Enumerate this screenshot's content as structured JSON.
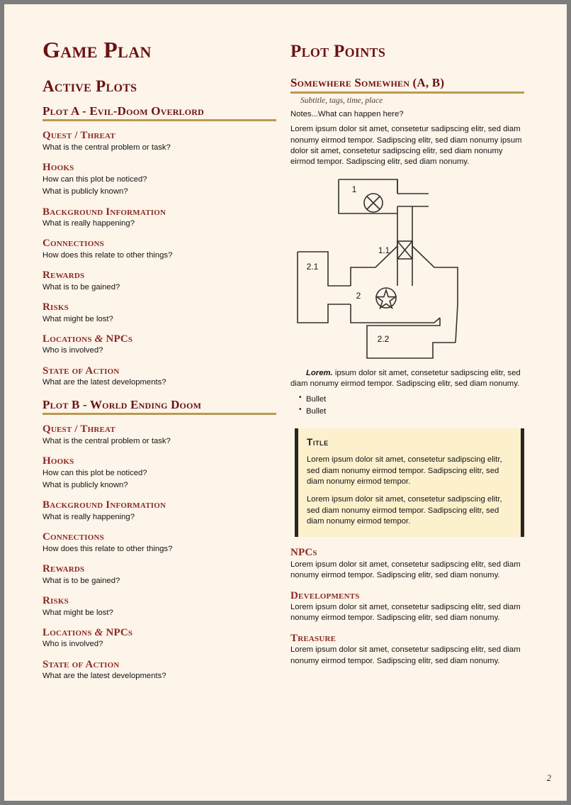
{
  "page": {
    "background": "#fdf4ea",
    "border_color": "#7d7d7d",
    "number": "2"
  },
  "colors": {
    "heading_dark_red": "#6b1212",
    "heading_red": "#8c2b22",
    "rule_gold": "#bb9950",
    "callout_bg": "#fdf0cd",
    "callout_bar": "#2a2420"
  },
  "left_column": {
    "title": "Game Plan",
    "section_heading": "Active Plots",
    "plots": [
      {
        "heading": "Plot A - Evil-Doom Overlord",
        "entries": [
          {
            "heading": "Quest / Threat",
            "lines": [
              "What is the central problem or task?"
            ]
          },
          {
            "heading": "Hooks",
            "lines": [
              "How can this plot be noticed?",
              "What is publicly known?"
            ]
          },
          {
            "heading": "Background Information",
            "lines": [
              "What is really happening?"
            ]
          },
          {
            "heading": "Connections",
            "lines": [
              "How does this relate to other things?"
            ]
          },
          {
            "heading": "Rewards",
            "lines": [
              "What is to be gained?"
            ]
          },
          {
            "heading": "Risks",
            "lines": [
              "What might be lost?"
            ]
          },
          {
            "heading_pre": "Locations",
            "heading_amp": "&",
            "heading_post": "NPCs",
            "lines": [
              "Who is involved?"
            ]
          },
          {
            "heading": "State of Action",
            "lines": [
              "What are the latest developments?"
            ]
          }
        ]
      },
      {
        "heading": "Plot B - World Ending Doom",
        "entries": [
          {
            "heading": "Quest / Threat",
            "lines": [
              "What is the central problem or task?"
            ]
          },
          {
            "heading": "Hooks",
            "lines": [
              "How can this plot be noticed?",
              "What is publicly known?"
            ]
          },
          {
            "heading": "Background Information",
            "lines": [
              "What is really happening?"
            ]
          },
          {
            "heading": "Connections",
            "lines": [
              "How does this relate to other things?"
            ]
          },
          {
            "heading": "Rewards",
            "lines": [
              "What is to be gained?"
            ]
          },
          {
            "heading": "Risks",
            "lines": [
              "What might be lost?"
            ]
          },
          {
            "heading_pre": "Locations",
            "heading_amp": "&",
            "heading_post": "NPCs",
            "lines": [
              "Who is involved?"
            ]
          },
          {
            "heading": "State of Action",
            "lines": [
              "What are the latest developments?"
            ]
          }
        ]
      }
    ]
  },
  "right_column": {
    "title": "Plot Points",
    "entry": {
      "heading": "Somewhere Somewhen (A, B)",
      "subtitle": "Subtitle, tags, time, place",
      "notes": "Notes...What can happen here?",
      "intro_paragraph": "Lorem ipsum dolor sit amet, consetetur sadipscing elitr, sed diam nonumy eirmod tempor. Sadipscing elitr, sed diam nonumy ipsum dolor sit amet, consetetur sadipscing elitr, sed diam nonumy eirmod tempor. Sadipscing elitr, sed diam nonumy.",
      "map": {
        "name": "dungeon-floorplan",
        "room_labels": [
          "1",
          "1.1",
          "2.1",
          "2",
          "2.2"
        ],
        "symbols": [
          "circled-cross-marker",
          "door-cross-marker",
          "circled-star-marker"
        ]
      },
      "post_map_lead": "Lorem.",
      "post_map_paragraph": "ipsum dolor sit amet, consetetur sadipscing elitr, sed diam nonumy eirmod tempor. Sadipscing elitr, sed diam nonumy.",
      "bullets": [
        "Bullet",
        "Bullet"
      ]
    },
    "callout": {
      "title": "Title",
      "paragraphs": [
        "Lorem ipsum dolor sit amet, consetetur sadipscing elitr, sed diam nonumy eirmod tempor. Sadipscing elitr, sed diam nonumy eirmod tempor.",
        "Lorem ipsum dolor sit amet, consetetur sadipscing elitr, sed diam nonumy eirmod tempor. Sadipscing elitr, sed diam nonumy eirmod tempor."
      ]
    },
    "sections": [
      {
        "heading": "NPCs",
        "text": "Lorem ipsum dolor sit amet, consetetur sadipscing elitr, sed diam nonumy eirmod tempor. Sadipscing elitr, sed diam nonumy."
      },
      {
        "heading": "Developments",
        "text": "Lorem ipsum dolor sit amet, consetetur sadipscing elitr, sed diam nonumy eirmod tempor. Sadipscing elitr, sed diam nonumy."
      },
      {
        "heading": "Treasure",
        "text": "Lorem ipsum dolor sit amet, consetetur sadipscing elitr, sed diam nonumy eirmod tempor. Sadipscing elitr, sed diam nonumy."
      }
    ]
  }
}
